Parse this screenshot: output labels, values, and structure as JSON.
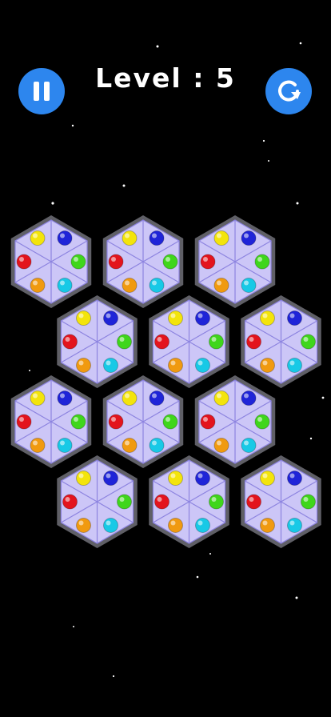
{
  "header": {
    "level_text": "Level : 5",
    "pause_icon": "pause-icon",
    "restart_icon": "restart-icon"
  },
  "colors": {
    "background": "#000000",
    "button": "#2d86ee",
    "tile_fill": "#ccc6f7",
    "tile_border": "#5f5f66",
    "tile_lines": "#8d84e0"
  },
  "board": {
    "rows": [
      {
        "tiles": 3,
        "offset": "left"
      },
      {
        "tiles": 3,
        "offset": "right"
      },
      {
        "tiles": 3,
        "offset": "left"
      },
      {
        "tiles": 3,
        "offset": "right"
      }
    ],
    "ball_order": [
      "yellow",
      "blue",
      "green",
      "cyan",
      "orange",
      "red"
    ],
    "ball_colors": {
      "yellow": "#f3e40c",
      "blue": "#1f24d8",
      "green": "#3fd61b",
      "cyan": "#17c9e6",
      "orange": "#f09a10",
      "red": "#e3141d"
    }
  }
}
